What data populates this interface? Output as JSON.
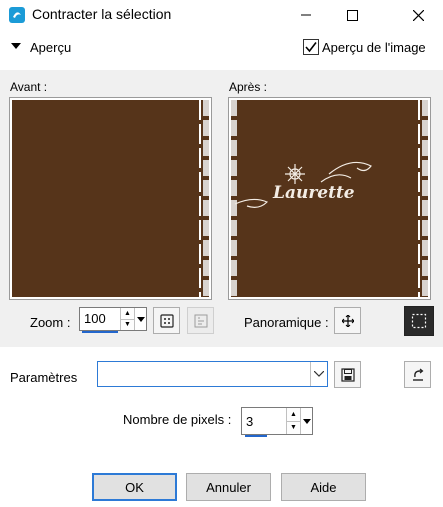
{
  "window": {
    "title": "Contracter la sélection",
    "icons": [
      "app-icon",
      "minimize-icon",
      "maximize-icon",
      "close-icon"
    ]
  },
  "preview": {
    "section_label": "Aperçu",
    "show_preview_label": "Aperçu de l'image",
    "show_preview_checked": true,
    "before_label": "Avant :",
    "after_label": "Après :",
    "watermark_text": "Laurette",
    "image_color": "#56341a"
  },
  "zoom": {
    "label": "Zoom :",
    "value": "100",
    "pan_label": "Panoramique :"
  },
  "params": {
    "label": "Paramètres",
    "preset_value": ""
  },
  "pixels": {
    "label": "Nombre de pixels :",
    "value": "3"
  },
  "buttons": {
    "ok": "OK",
    "cancel": "Annuler",
    "help": "Aide"
  },
  "colors": {
    "accent": "#2d7ad6",
    "panel_bg": "#f0f0f0"
  }
}
